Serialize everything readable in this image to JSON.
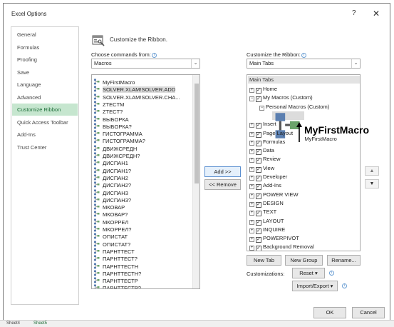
{
  "window": {
    "title": "Excel Options",
    "help": "?",
    "close": "✕"
  },
  "sidebar": {
    "items": [
      {
        "label": "General",
        "active": false
      },
      {
        "label": "Formulas",
        "active": false
      },
      {
        "label": "Proofing",
        "active": false
      },
      {
        "label": "Save",
        "active": false
      },
      {
        "label": "Language",
        "active": false
      },
      {
        "label": "Advanced",
        "active": false
      },
      {
        "label": "Customize Ribbon",
        "active": true
      },
      {
        "label": "Quick Access Toolbar",
        "active": false
      },
      {
        "label": "Add-Ins",
        "active": false
      },
      {
        "label": "Trust Center",
        "active": false
      }
    ]
  },
  "main": {
    "header": "Customize the Ribbon.",
    "choose_label": "Choose commands from:",
    "choose_value": "Macros",
    "customize_label": "Customize the Ribbon:",
    "customize_value": "Main Tabs",
    "commands": [
      "MyFirstMacro",
      "SOLVER.XLAM!SOLVER.ADD",
      "SOLVER.XLAM!SOLVER.CHA...",
      "ZTECTM",
      "ZTECT?",
      "ВЫБОРКА",
      "ВЫБОРКА?",
      "ГИСТОГРАММА",
      "ГИСТОГРАММА?",
      "ДВИЖСРЕДН",
      "ДВИЖСРЕДН?",
      "ДИСПАН1",
      "ДИСПАН1?",
      "ДИСПАН2",
      "ДИСПАН2?",
      "ДИСПАН3",
      "ДИСПАН3?",
      "МКОВАР",
      "МКОВАР?",
      "МКОРРЕЛ",
      "МКОРРЕЛ?",
      "ОПИСТАТ",
      "ОПИСТАТ?",
      "ПАРНТТЕСТ",
      "ПАРНТТЕСТ?",
      "ПАРНТТЕСТН",
      "ПАРНТТЕСТН?",
      "ПАРНТТЕСТР",
      "ПАРНТТЕСТР?"
    ],
    "selected_command": 1,
    "add_button": "Add >>",
    "remove_button": "<< Remove",
    "tabs_header": "Main Tabs",
    "tabs": [
      {
        "label": "Home",
        "expand": "⊞",
        "checked": true,
        "indent": 0
      },
      {
        "label": "My Macros (Custom)",
        "expand": "⊟",
        "checked": true,
        "indent": 0
      },
      {
        "label": "Personal Macros (Custom)",
        "expand": "⊟",
        "checked": null,
        "indent": 1
      },
      {
        "label": "MyFirstMacro",
        "expand": "",
        "checked": null,
        "indent": 2,
        "selected": true,
        "macro": true
      },
      {
        "label": "Insert",
        "expand": "⊞",
        "checked": true,
        "indent": 0
      },
      {
        "label": "Page Layout",
        "expand": "⊞",
        "checked": true,
        "indent": 0
      },
      {
        "label": "Formulas",
        "expand": "⊞",
        "checked": true,
        "indent": 0
      },
      {
        "label": "Data",
        "expand": "⊞",
        "checked": true,
        "indent": 0
      },
      {
        "label": "Review",
        "expand": "⊞",
        "checked": true,
        "indent": 0
      },
      {
        "label": "View",
        "expand": "⊞",
        "checked": true,
        "indent": 0
      },
      {
        "label": "Developer",
        "expand": "⊞",
        "checked": true,
        "indent": 0
      },
      {
        "label": "Add-Ins",
        "expand": "⊞",
        "checked": true,
        "indent": 0
      },
      {
        "label": "POWER VIEW",
        "expand": "⊞",
        "checked": true,
        "indent": 0
      },
      {
        "label": "DESIGN",
        "expand": "⊞",
        "checked": true,
        "indent": 0
      },
      {
        "label": "TEXT",
        "expand": "⊞",
        "checked": true,
        "indent": 0
      },
      {
        "label": "LAYOUT",
        "expand": "⊞",
        "checked": true,
        "indent": 0
      },
      {
        "label": "INQUIRE",
        "expand": "⊞",
        "checked": true,
        "indent": 0
      },
      {
        "label": "POWERPIVOT",
        "expand": "⊞",
        "checked": true,
        "indent": 0
      },
      {
        "label": "Background Removal",
        "expand": "⊞",
        "checked": true,
        "indent": 0
      }
    ],
    "new_tab": "New Tab",
    "new_group": "New Group",
    "rename": "Rename...",
    "customizations_label": "Customizations:",
    "reset": "Reset ▾",
    "import_export": "Import/Export ▾",
    "move_up": "▲",
    "move_down": "▼"
  },
  "footer": {
    "ok": "OK",
    "cancel": "Cancel"
  },
  "annotation": {
    "label": "MyFirstMacro"
  },
  "sheet_tabs": [
    "Sheet4",
    "Sheet5"
  ],
  "colors": {
    "active_nav_bg": "#c6e6cf",
    "active_nav_text": "#1f6f3a",
    "selection": "#dcdcdc"
  }
}
